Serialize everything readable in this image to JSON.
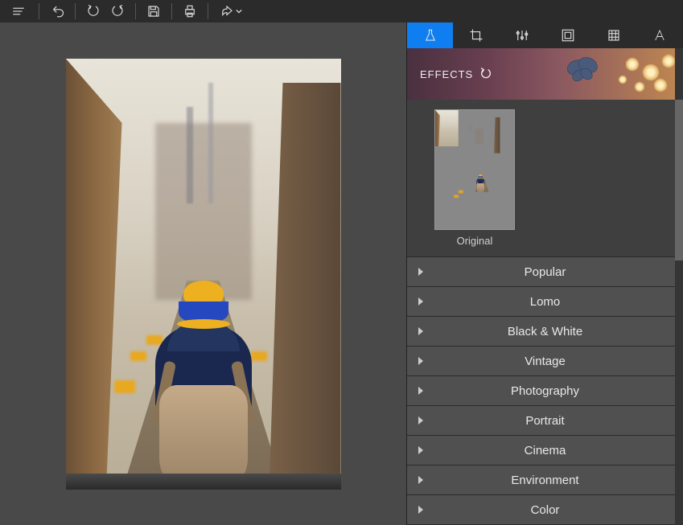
{
  "toolbar": {
    "icons": [
      "menu",
      "undo",
      "redo",
      "redo2",
      "save",
      "print",
      "share"
    ]
  },
  "sidebar": {
    "tabs": [
      "effects",
      "crop",
      "adjust",
      "frame",
      "texture",
      "text"
    ],
    "active_tab": 0,
    "header_label": "EFFECTS",
    "thumbnail_label": "Original",
    "categories": [
      "Popular",
      "Lomo",
      "Black & White",
      "Vintage",
      "Photography",
      "Portrait",
      "Cinema",
      "Environment",
      "Color"
    ]
  }
}
